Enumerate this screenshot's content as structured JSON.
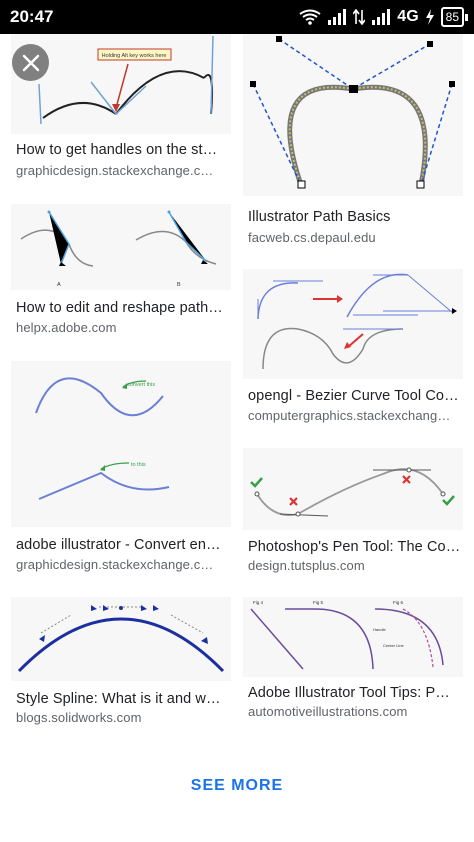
{
  "status_bar": {
    "time": "20:47",
    "network": "4G",
    "battery": "85",
    "icons": [
      "wifi-icon",
      "signal-icon",
      "data-arrows-icon",
      "signal-icon",
      "charging-icon",
      "battery-icon"
    ]
  },
  "close_button": {
    "icon": "close-icon"
  },
  "results": [
    {
      "title": "How to get handles on the st…",
      "site": "graphicdesign.stackexchange.c…",
      "annotation": "Holding Alt key works here"
    },
    {
      "title": "Illustrator Path Basics",
      "site": "facweb.cs.depaul.edu"
    },
    {
      "title": "How to edit and reshape path…",
      "site": "helpx.adobe.com",
      "labels": [
        "A",
        "B"
      ]
    },
    {
      "title": "opengl - Bezier Curve Tool Co…",
      "site": "computergraphics.stackexchang…"
    },
    {
      "title": "adobe illustrator - Convert en…",
      "site": "graphicdesign.stackexchange.c…",
      "annotations": [
        "convert this",
        "to this"
      ]
    },
    {
      "title": "Photoshop's Pen Tool: The Co…",
      "site": "design.tutsplus.com"
    },
    {
      "title": "Style Spline: What is it and w…",
      "site": "blogs.solidworks.com"
    },
    {
      "title": "Adobe Illustrator Tool Tips: P…",
      "site": "automotiveillustrations.com",
      "labels": [
        "Fig 4",
        "Fig 5",
        "Fig 6",
        "Handle",
        "Center Line"
      ]
    }
  ],
  "see_more": "SEE MORE",
  "colors": {
    "accent": "#1a73e8",
    "title": "#202124",
    "site": "#5f6368"
  }
}
